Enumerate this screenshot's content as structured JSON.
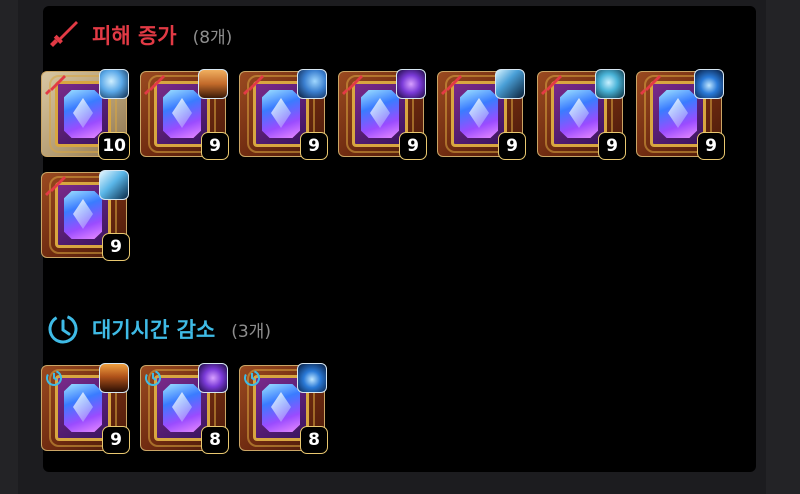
{
  "sections": [
    {
      "title": "피해 증가",
      "count": "(8개)",
      "icon": "sword-icon",
      "color": "#e23a45",
      "items": [
        {
          "level": "10",
          "skill_icon": "water-wave-icon",
          "skill_color": "#5aa8e8",
          "tile": "light"
        },
        {
          "level": "9",
          "skill_icon": "fire-pillar-icon",
          "skill_color": "#c26a2a",
          "tile": "dark"
        },
        {
          "level": "9",
          "skill_icon": "blue-crescent-icon",
          "skill_color": "#3a7fd0",
          "tile": "dark"
        },
        {
          "level": "9",
          "skill_icon": "purple-orb-icon",
          "skill_color": "#7a3ad8",
          "tile": "dark"
        },
        {
          "level": "9",
          "skill_icon": "lightning-strike-icon",
          "skill_color": "#4aa0d8",
          "tile": "dark"
        },
        {
          "level": "9",
          "skill_icon": "cyan-swirl-icon",
          "skill_color": "#4ab4d8",
          "tile": "dark"
        },
        {
          "level": "9",
          "skill_icon": "blue-burst-icon",
          "skill_color": "#2a7ad8",
          "tile": "dark"
        },
        {
          "level": "9",
          "skill_icon": "ice-slash-icon",
          "skill_color": "#5ab6e8",
          "tile": "dark"
        }
      ]
    },
    {
      "title": "대기시간 감소",
      "count": "(3개)",
      "icon": "clock-icon",
      "color": "#3fbbe6",
      "items": [
        {
          "level": "9",
          "skill_icon": "warrior-figure-icon",
          "skill_color": "#b0521a",
          "tile": "dark"
        },
        {
          "level": "8",
          "skill_icon": "purple-orb-icon",
          "skill_color": "#7a3ad8",
          "tile": "dark"
        },
        {
          "level": "8",
          "skill_icon": "blue-burst-icon",
          "skill_color": "#2a7ad8",
          "tile": "dark"
        }
      ]
    }
  ]
}
